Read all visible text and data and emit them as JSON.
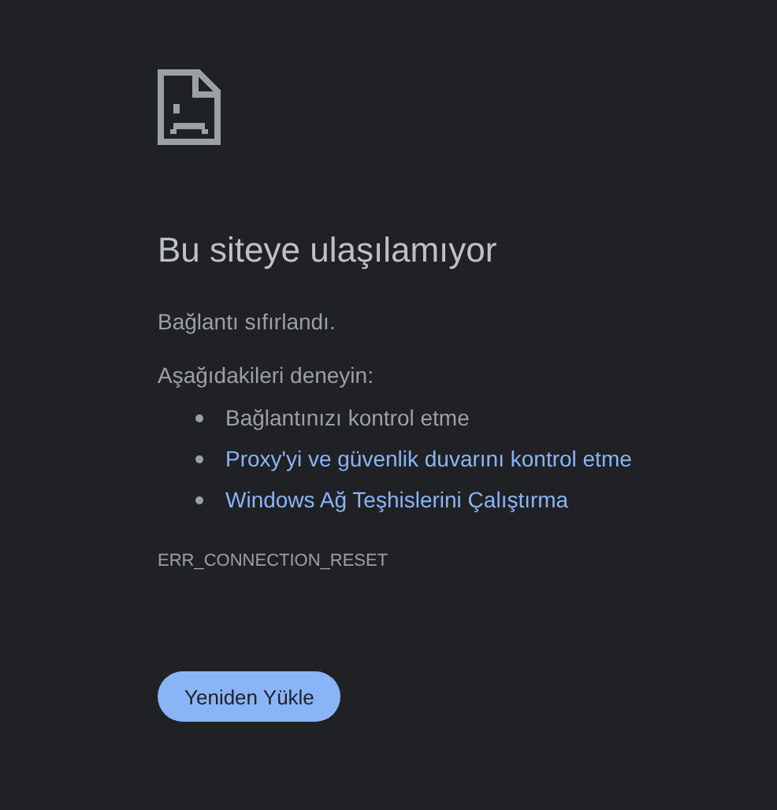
{
  "title": "Bu siteye ulaşılamıyor",
  "message": "Bağlantı sıfırlandı.",
  "suggestions_heading": "Aşağıdakileri deneyin:",
  "suggestions": [
    {
      "kind": "text",
      "label": "Bağlantınızı kontrol etme"
    },
    {
      "kind": "link",
      "label": "Proxy'yi ve güvenlik duvarını kontrol etme"
    },
    {
      "kind": "link",
      "label": "Windows Ağ Teşhislerini Çalıştırma"
    }
  ],
  "error_code": "ERR_CONNECTION_RESET",
  "reload_button": "Yeniden Yükle"
}
